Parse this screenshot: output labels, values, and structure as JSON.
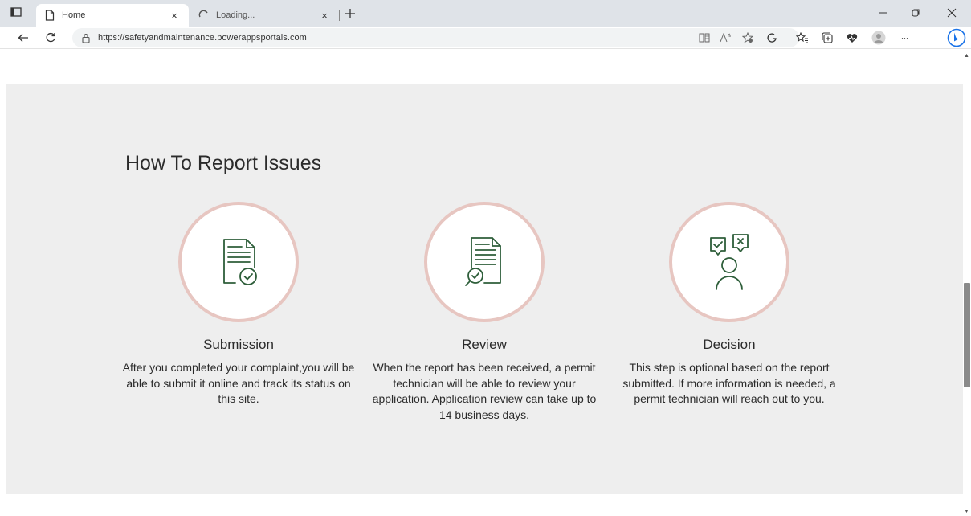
{
  "browser": {
    "tabs": [
      {
        "label": "Home",
        "icon": "page-icon"
      },
      {
        "label": "Loading...",
        "icon": "loading-icon"
      }
    ],
    "new_tab_symbol": "+",
    "close_symbol": "×",
    "url": "https://safetyandmaintenance.powerappsportals.com",
    "icons": [
      "tab-actions-icon",
      "back-icon",
      "refresh-icon",
      "lock-icon",
      "immersive-reader-icon",
      "read-aloud-icon",
      "add-favorite-icon",
      "extensions-icon",
      "favorites-icon",
      "collections-icon",
      "browser-essentials-icon",
      "profile-icon",
      "more-icon",
      "bing-icon",
      "minimize-icon",
      "restore-icon",
      "close-window-icon"
    ],
    "more_label": "···",
    "accent_color": "#1a73e8"
  },
  "page": {
    "section_title": "How To Report Issues",
    "steps": [
      {
        "title": "Submission",
        "text": "After you completed your complaint,you will be able to submit it online and track its status on this site.",
        "icon": "document-check-icon"
      },
      {
        "title": "Review",
        "text": "When the report has been received, a permit technician will be able to review your application. Application review can take up to 14 business days.",
        "icon": "document-search-icon"
      },
      {
        "title": "Decision",
        "text": "This step is optional based on the report submitted. If more information is needed, a permit technician will reach out to you.",
        "icon": "person-decision-icon"
      }
    ],
    "colors": {
      "section_background": "#eeeeee",
      "circle_border": "#e7c6c1",
      "icon_stroke": "#2e5e3a",
      "text": "#2b2b2b"
    }
  }
}
